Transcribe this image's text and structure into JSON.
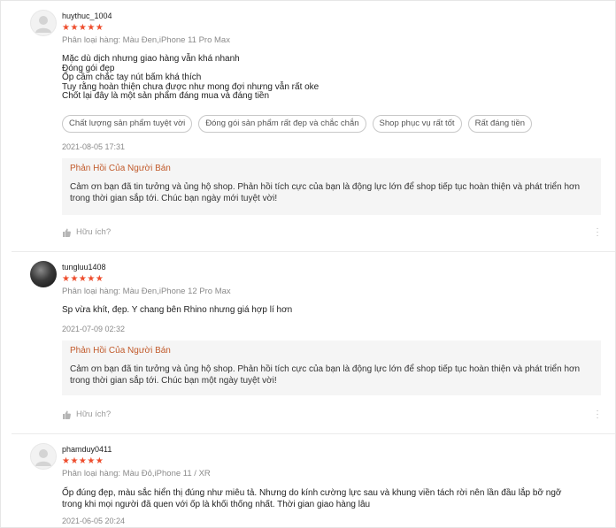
{
  "reviews": [
    {
      "username": "huythuc_1004",
      "stars": "★★★★★",
      "variant": "Phân loại hàng: Màu Đen,iPhone 11 Pro Max",
      "content": [
        "Mặc dù dịch nhưng giao hàng vẫn khá nhanh",
        "Đóng gói đẹp",
        "Ốp cầm chắc tay nút bấm khá thích",
        "Tuy rằng hoàn thiện chưa được như mong đợi nhưng vẫn rất oke",
        "Chốt lại đây là một sản phẩm đáng mua và đáng tiền"
      ],
      "tags": [
        "Chất lượng sản phẩm tuyệt vời",
        "Đóng gói sản phẩm rất đẹp và chắc chắn",
        "Shop phục vụ rất tốt",
        "Rất đáng tiền"
      ],
      "timestamp": "2021-08-05 17:31",
      "reply_title": "Phản Hồi Của Người Bán",
      "reply_text": "Cảm ơn bạn đã tin tưởng và ủng hộ shop. Phản hồi tích cực của bạn là động lực lớn để shop tiếp tục hoàn thiện và phát triển hơn trong thời gian sắp tới. Chúc bạn ngày mới tuyệt vời!",
      "helpful": "Hữu ích?"
    },
    {
      "username": "tungluu1408",
      "stars": "★★★★★",
      "variant": "Phân loại hàng: Màu Đen,iPhone 12 Pro Max",
      "content": [
        "Sp vừa khít, đẹp. Y chang bên Rhino nhưng giá hợp lí hơn"
      ],
      "timestamp": "2021-07-09 02:32",
      "reply_title": "Phản Hồi Của Người Bán",
      "reply_text": "Cảm ơn bạn đã tin tưởng và ủng hộ shop. Phản hồi tích cực của bạn là động lực lớn để shop tiếp tục hoàn thiện và phát triển hơn trong thời gian sắp tới. Chúc bạn một ngày tuyệt vời!",
      "helpful": "Hữu ích?"
    },
    {
      "username": "phamduy0411",
      "stars": "★★★★★",
      "variant": "Phân loại hàng: Màu Đỏ,iPhone 11 / XR",
      "content": [
        "Ốp đúng đẹp, màu sắc hiển thị đúng như miêu tả. Nhưng do kính cường lực sau và khung viền tách rời nên lần đầu lắp bỡ ngỡ",
        "trong khi mọi người đã quen với ốp là khối thống nhất. Thời gian giao hàng lâu"
      ],
      "timestamp": "2021-06-05 20:24"
    }
  ],
  "colors": {
    "star": "#ee4d2d",
    "reply_title": "#c15a2b",
    "reply_bg": "#f5f5f5"
  },
  "icons": {
    "helpful": "thumb-up-icon",
    "more": "more-vertical-icon",
    "avatar": "user-icon"
  }
}
